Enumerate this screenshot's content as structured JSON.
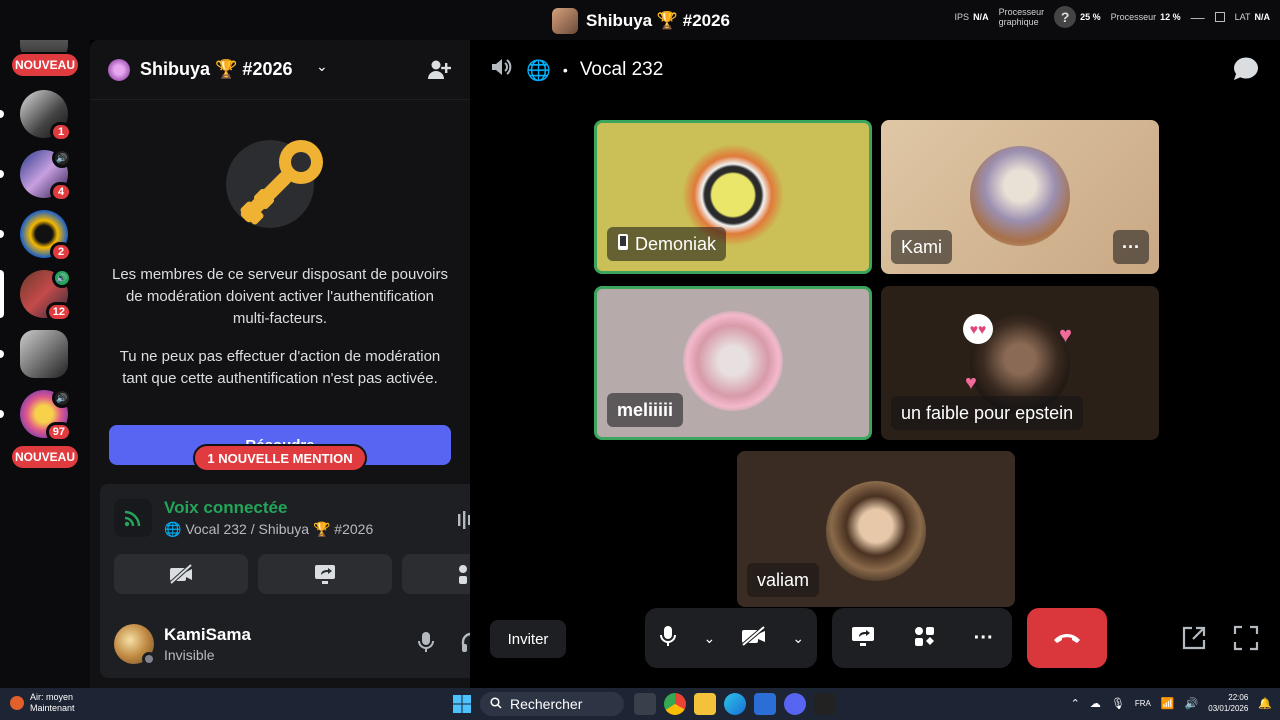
{
  "titlebar": {
    "title": "Shibuya 🏆 #2026",
    "overlay": {
      "ips_label": "IPS",
      "ips_value": "N/A",
      "gpu_label_1": "Processeur",
      "gpu_label_2": "graphique",
      "gpu_value": "25 %",
      "cpu_label": "Processeur",
      "cpu_value": "12 %",
      "lat_label": "LAT",
      "lat_value": "N/A"
    }
  },
  "server_rail": {
    "new_label_top": "NOUVEAU",
    "new_label_bottom": "NOUVEAU",
    "servers": [
      {
        "badge": "1"
      },
      {
        "badge": "4"
      },
      {
        "badge": "2"
      },
      {
        "badge": "12"
      },
      {
        "badge": ""
      },
      {
        "badge": "97"
      }
    ]
  },
  "server_header": {
    "name": "Shibuya 🏆 #2026"
  },
  "mfa": {
    "paragraph1": "Les membres de ce serveur disposant de pouvoirs de modération doivent activer l'authentification multi-facteurs.",
    "paragraph2": "Tu ne peux pas effectuer d'action de modération tant que cette authentification n'est pas activée.",
    "button_label": "Résoudre",
    "mention_pill": "1 NOUVELLE MENTION"
  },
  "voice": {
    "status": "Voix connectée",
    "channel_path": "Vocal 232 / Shibuya 🏆 #2026"
  },
  "user": {
    "name": "KamiSama",
    "status": "Invisible"
  },
  "call": {
    "channel_name": "Vocal 232",
    "participants": [
      {
        "name": "Demoniak",
        "mobile": true
      },
      {
        "name": "Kami"
      },
      {
        "name": "meliiiii"
      },
      {
        "name": "un faible pour epstein"
      },
      {
        "name": "valiam"
      }
    ],
    "invite_label": "Inviter",
    "more_label": "···"
  },
  "taskbar": {
    "weather_line1": "Air: moyen",
    "weather_line2": "Maintenant",
    "search_placeholder": "Rechercher",
    "lang": "FRA",
    "time": "22:06",
    "date": "03/01/2026"
  },
  "colors": {
    "accent": "#5865f2",
    "danger": "#da373c",
    "connected": "#23a55a",
    "speaking": "#3ba55c"
  }
}
